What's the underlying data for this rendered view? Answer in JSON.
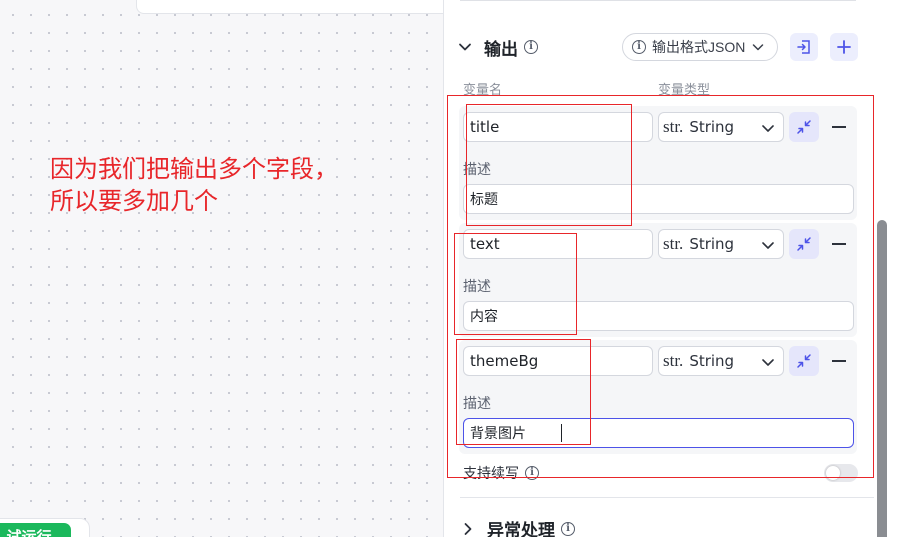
{
  "canvas": {
    "annotation_line1": "因为我们把输出多个字段，",
    "annotation_line2": "所以要多加几个",
    "run_button_label": "试运行"
  },
  "output_section": {
    "title": "输出",
    "format_select": {
      "value": "输出格式JSON"
    },
    "columns": {
      "name": "变量名",
      "type": "变量类型"
    },
    "fields": [
      {
        "name": "title",
        "type_prefix": "str.",
        "type": "String",
        "desc_label": "描述",
        "desc": "标题"
      },
      {
        "name": "text",
        "type_prefix": "str.",
        "type": "String",
        "desc_label": "描述",
        "desc": "内容"
      },
      {
        "name": "themeBg",
        "type_prefix": "str.",
        "type": "String",
        "desc_label": "描述",
        "desc": "背景图片"
      }
    ],
    "stream_label": "支持续写",
    "stream_enabled": false
  },
  "exception_section": {
    "title": "异常处理"
  },
  "colors": {
    "annotation_red": "#e8262a",
    "accent": "#4d53e8",
    "run_green": "#1bb85c"
  }
}
